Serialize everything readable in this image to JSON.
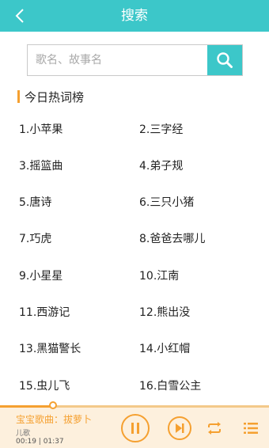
{
  "header": {
    "title": "搜索"
  },
  "search": {
    "placeholder": "歌名、故事名"
  },
  "hot": {
    "title": "今日热词榜",
    "items": [
      "1.小苹果",
      "2.三字经",
      "3.摇篮曲",
      "4.弟子规",
      "5.唐诗",
      "6.三只小猪",
      "7.巧虎",
      "8.爸爸去哪儿",
      "9.小星星",
      "10.江南",
      "11.西游记",
      "12.熊出没",
      "13.黑猫警长",
      "14.小红帽",
      "15.虫儿飞",
      "16.白雪公主"
    ]
  },
  "player": {
    "title": "宝宝歌曲：拔萝卜",
    "category": "儿歌",
    "time": "00:19 | 01:37",
    "progress": 0.196
  },
  "colors": {
    "accent": "#3cc7c9",
    "orange": "#f5a030",
    "player_bg": "#fdf0dd"
  },
  "icons": {
    "back": "chevron-left-icon",
    "search": "search-icon",
    "pause": "pause-icon",
    "next": "next-track-icon",
    "repeat": "repeat-icon",
    "playlist": "playlist-icon"
  }
}
